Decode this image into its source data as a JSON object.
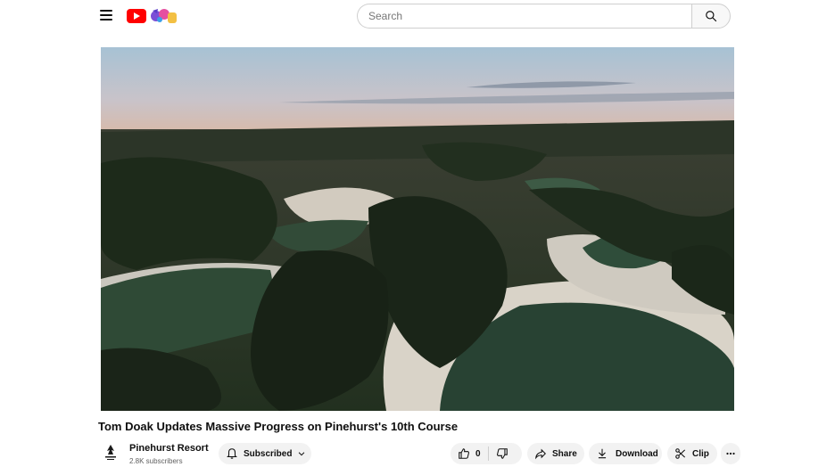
{
  "header": {
    "menu_icon": "hamburger-menu-icon",
    "logo_icon": "youtube-logo-icon",
    "search": {
      "placeholder": "Search",
      "value": ""
    },
    "search_icon": "search-icon"
  },
  "video": {
    "title": "Tom Doak Updates Massive Progress on Pinehurst's 10th Course",
    "thumbnail_description_icon": "video-player"
  },
  "channel": {
    "name": "Pinehurst Resort",
    "subscribers": "2.8K subscribers",
    "avatar_icon": "pinehurst-logo-icon"
  },
  "actions": {
    "subscribed_label": "Subscribed",
    "like_count": "0",
    "share_label": "Share",
    "download_label": "Download",
    "clip_label": "Clip",
    "more_icon": "more-horizontal-icon"
  },
  "colors": {
    "brand_red": "#ff0000",
    "pill_bg": "#f2f2f2",
    "text_primary": "#0f0f0f",
    "text_secondary": "#606060"
  }
}
